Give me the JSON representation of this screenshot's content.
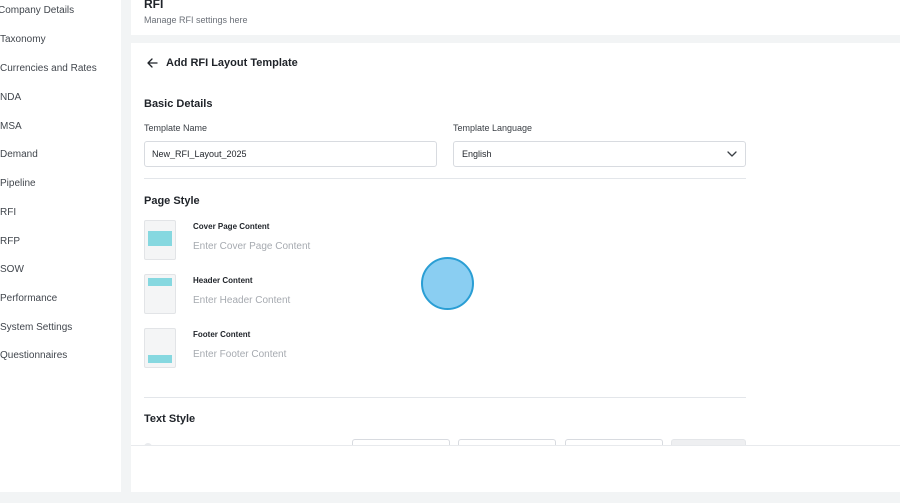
{
  "sidebar": {
    "items": [
      {
        "label": "Company Details"
      },
      {
        "label": "Taxonomy"
      },
      {
        "label": "Currencies and Rates"
      },
      {
        "label": "NDA"
      },
      {
        "label": "MSA"
      },
      {
        "label": "Demand"
      },
      {
        "label": "Pipeline"
      },
      {
        "label": "RFI"
      },
      {
        "label": "RFP"
      },
      {
        "label": "SOW"
      },
      {
        "label": "Performance"
      },
      {
        "label": "System Settings"
      },
      {
        "label": "Questionnaires"
      }
    ]
  },
  "header": {
    "title": "RFI",
    "subtitle": "Manage RFI settings here"
  },
  "form": {
    "back_icon": "arrow-left-icon",
    "title": "Add RFI Layout Template",
    "basic_details": {
      "heading": "Basic Details",
      "template_name_label": "Template Name",
      "template_name_value": "New_RFI_Layout_2025",
      "template_language_label": "Template Language",
      "template_language_value": "English",
      "dropdown_icon": "chevron-down-icon"
    },
    "page_style": {
      "heading": "Page Style",
      "rows": [
        {
          "label": "Cover Page Content",
          "placeholder": "Enter Cover Page Content"
        },
        {
          "label": "Header Content",
          "placeholder": "Enter Header Content"
        },
        {
          "label": "Footer Content",
          "placeholder": "Enter Footer Content"
        }
      ]
    },
    "text_style": {
      "heading": "Text Style"
    }
  },
  "colors": {
    "accent_thumb": "#86d8e0",
    "click_indicator": "#7ac7f0"
  }
}
